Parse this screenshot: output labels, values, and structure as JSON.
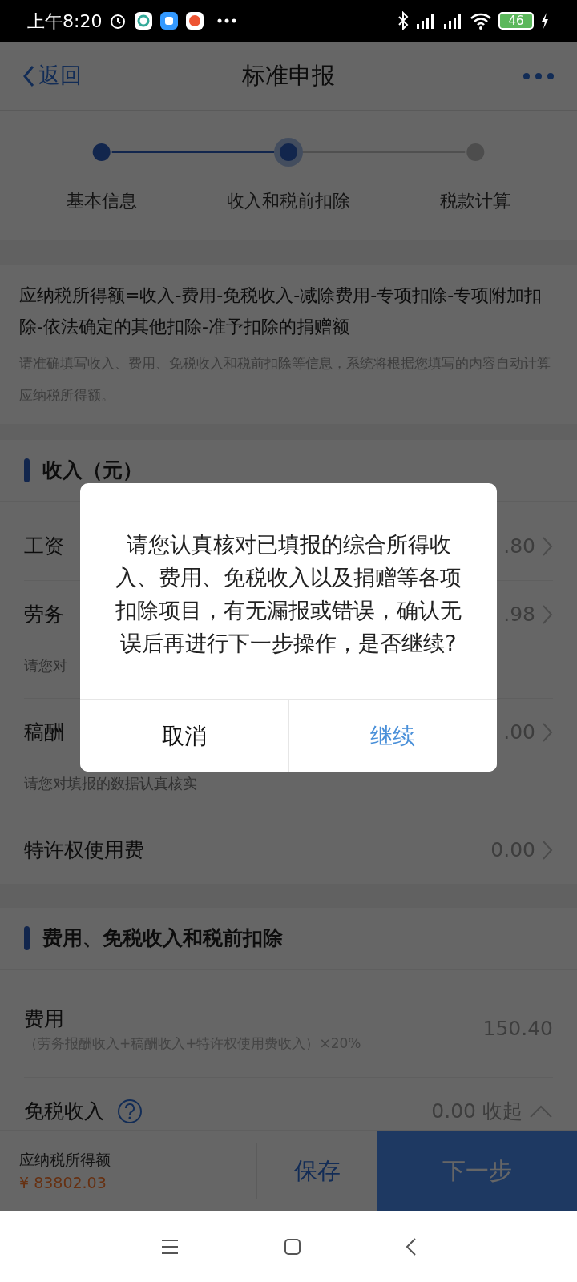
{
  "status_bar": {
    "time": "上午8:20",
    "battery": "46"
  },
  "header": {
    "back": "返回",
    "title": "标准申报"
  },
  "steps": [
    {
      "label": "基本信息",
      "completed": true,
      "selected": false
    },
    {
      "label": "收入和税前扣除",
      "completed": false,
      "selected": true
    },
    {
      "label": "税款计算",
      "completed": false,
      "selected": false
    }
  ],
  "formula": {
    "text": "应纳税所得额=收入-费用-免税收入-减除费用-专项扣除-专项附加扣除-依法确定的其他扣除-准予扣除的捐赠额",
    "hint": "请准确填写收入、费用、免税收入和税前扣除等信息，系统将根据您填写的内容自动计算应纳税所得额。"
  },
  "sections": [
    {
      "title": "收入（元）",
      "rows": [
        {
          "kind": "link",
          "label": "工资",
          "value": ".80"
        },
        {
          "kind": "link",
          "label": "劳务",
          "value": ".98",
          "hint": "请您对"
        },
        {
          "kind": "link",
          "label": "稿酬",
          "value": ".00",
          "hint": "请您对填报的数据认真核实"
        },
        {
          "kind": "link",
          "label": "特许权使用费",
          "value": "0.00"
        }
      ]
    },
    {
      "title": "费用、免税收入和税前扣除",
      "rows": [
        {
          "kind": "plain",
          "label": "费用",
          "sub": "（劳务报酬收入+稿酬收入+特许权使用费收入）×20%",
          "value": "150.40"
        },
        {
          "kind": "expand",
          "label": "免税收入",
          "help": true,
          "value": "0.00",
          "toggle": "收起",
          "expanded": true
        }
      ]
    }
  ],
  "footer": {
    "label": "应纳税所得额",
    "amount": "¥ 83802.03",
    "save": "保存",
    "next": "下一步"
  },
  "dialog": {
    "message": "请您认真核对已填报的综合所得收入、费用、免税收入以及捐赠等各项扣除项目，有无漏报或错误，确认无误后再进行下一步操作，是否继续?",
    "cancel": "取消",
    "confirm": "继续"
  }
}
